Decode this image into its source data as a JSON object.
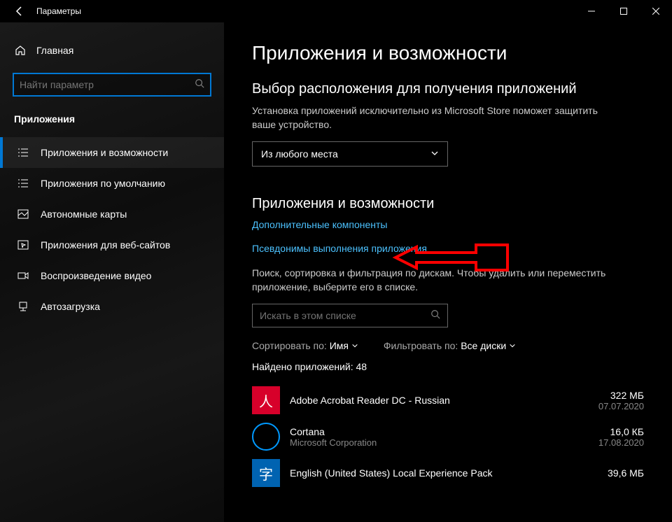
{
  "titlebar": {
    "title": "Параметры"
  },
  "sidebar": {
    "home": "Главная",
    "search_placeholder": "Найти параметр",
    "heading": "Приложения",
    "items": [
      {
        "label": "Приложения и возможности"
      },
      {
        "label": "Приложения по умолчанию"
      },
      {
        "label": "Автономные карты"
      },
      {
        "label": "Приложения для веб-сайтов"
      },
      {
        "label": "Воспроизведение видео"
      },
      {
        "label": "Автозагрузка"
      }
    ]
  },
  "main": {
    "page_title": "Приложения и возможности",
    "section1_title": "Выбор расположения для получения приложений",
    "section1_desc": "Установка приложений исключительно из Microsoft Store поможет защитить ваше устройство.",
    "dropdown_value": "Из любого места",
    "section2_title": "Приложения и возможности",
    "link_optional": "Дополнительные компоненты",
    "link_aliases": "Псевдонимы выполнения приложения",
    "list_desc": "Поиск, сортировка и фильтрация по дискам. Чтобы удалить или переместить приложение, выберите его в списке.",
    "list_search_placeholder": "Искать в этом списке",
    "sort_label": "Сортировать по:",
    "sort_value": "Имя",
    "filter_label": "Фильтровать по:",
    "filter_value": "Все диски",
    "found_label": "Найдено приложений: 48",
    "apps": [
      {
        "name": "Adobe Acrobat Reader DC - Russian",
        "publisher": "",
        "size": "322 МБ",
        "date": "07.07.2020",
        "color": "#d7002a",
        "glyph": "人"
      },
      {
        "name": "Cortana",
        "publisher": "Microsoft Corporation",
        "size": "16,0 КБ",
        "date": "17.08.2020",
        "color": "#000",
        "glyph": "◯"
      },
      {
        "name": "English (United States) Local Experience Pack",
        "publisher": "",
        "size": "39,6 МБ",
        "date": "",
        "color": "#0063b1",
        "glyph": "字"
      }
    ]
  }
}
